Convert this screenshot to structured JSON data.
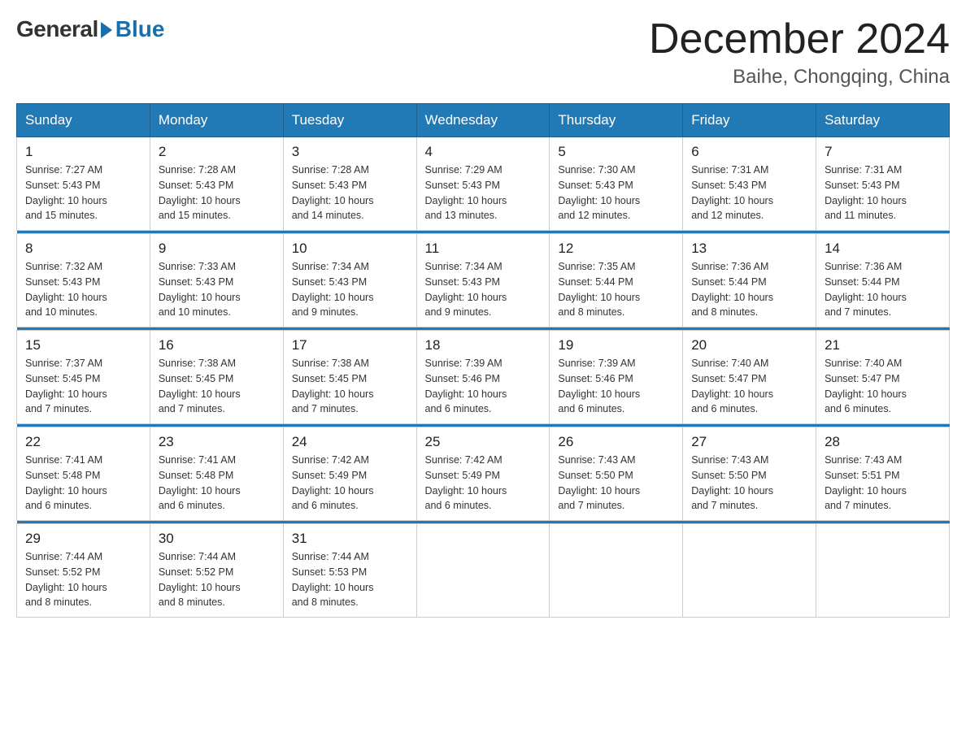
{
  "header": {
    "logo_general": "General",
    "logo_blue": "Blue",
    "month_title": "December 2024",
    "location": "Baihe, Chongqing, China"
  },
  "weekdays": [
    "Sunday",
    "Monday",
    "Tuesday",
    "Wednesday",
    "Thursday",
    "Friday",
    "Saturday"
  ],
  "weeks": [
    [
      {
        "day": "1",
        "sunrise": "7:27 AM",
        "sunset": "5:43 PM",
        "daylight": "10 hours and 15 minutes."
      },
      {
        "day": "2",
        "sunrise": "7:28 AM",
        "sunset": "5:43 PM",
        "daylight": "10 hours and 15 minutes."
      },
      {
        "day": "3",
        "sunrise": "7:28 AM",
        "sunset": "5:43 PM",
        "daylight": "10 hours and 14 minutes."
      },
      {
        "day": "4",
        "sunrise": "7:29 AM",
        "sunset": "5:43 PM",
        "daylight": "10 hours and 13 minutes."
      },
      {
        "day": "5",
        "sunrise": "7:30 AM",
        "sunset": "5:43 PM",
        "daylight": "10 hours and 12 minutes."
      },
      {
        "day": "6",
        "sunrise": "7:31 AM",
        "sunset": "5:43 PM",
        "daylight": "10 hours and 12 minutes."
      },
      {
        "day": "7",
        "sunrise": "7:31 AM",
        "sunset": "5:43 PM",
        "daylight": "10 hours and 11 minutes."
      }
    ],
    [
      {
        "day": "8",
        "sunrise": "7:32 AM",
        "sunset": "5:43 PM",
        "daylight": "10 hours and 10 minutes."
      },
      {
        "day": "9",
        "sunrise": "7:33 AM",
        "sunset": "5:43 PM",
        "daylight": "10 hours and 10 minutes."
      },
      {
        "day": "10",
        "sunrise": "7:34 AM",
        "sunset": "5:43 PM",
        "daylight": "10 hours and 9 minutes."
      },
      {
        "day": "11",
        "sunrise": "7:34 AM",
        "sunset": "5:43 PM",
        "daylight": "10 hours and 9 minutes."
      },
      {
        "day": "12",
        "sunrise": "7:35 AM",
        "sunset": "5:44 PM",
        "daylight": "10 hours and 8 minutes."
      },
      {
        "day": "13",
        "sunrise": "7:36 AM",
        "sunset": "5:44 PM",
        "daylight": "10 hours and 8 minutes."
      },
      {
        "day": "14",
        "sunrise": "7:36 AM",
        "sunset": "5:44 PM",
        "daylight": "10 hours and 7 minutes."
      }
    ],
    [
      {
        "day": "15",
        "sunrise": "7:37 AM",
        "sunset": "5:45 PM",
        "daylight": "10 hours and 7 minutes."
      },
      {
        "day": "16",
        "sunrise": "7:38 AM",
        "sunset": "5:45 PM",
        "daylight": "10 hours and 7 minutes."
      },
      {
        "day": "17",
        "sunrise": "7:38 AM",
        "sunset": "5:45 PM",
        "daylight": "10 hours and 7 minutes."
      },
      {
        "day": "18",
        "sunrise": "7:39 AM",
        "sunset": "5:46 PM",
        "daylight": "10 hours and 6 minutes."
      },
      {
        "day": "19",
        "sunrise": "7:39 AM",
        "sunset": "5:46 PM",
        "daylight": "10 hours and 6 minutes."
      },
      {
        "day": "20",
        "sunrise": "7:40 AM",
        "sunset": "5:47 PM",
        "daylight": "10 hours and 6 minutes."
      },
      {
        "day": "21",
        "sunrise": "7:40 AM",
        "sunset": "5:47 PM",
        "daylight": "10 hours and 6 minutes."
      }
    ],
    [
      {
        "day": "22",
        "sunrise": "7:41 AM",
        "sunset": "5:48 PM",
        "daylight": "10 hours and 6 minutes."
      },
      {
        "day": "23",
        "sunrise": "7:41 AM",
        "sunset": "5:48 PM",
        "daylight": "10 hours and 6 minutes."
      },
      {
        "day": "24",
        "sunrise": "7:42 AM",
        "sunset": "5:49 PM",
        "daylight": "10 hours and 6 minutes."
      },
      {
        "day": "25",
        "sunrise": "7:42 AM",
        "sunset": "5:49 PM",
        "daylight": "10 hours and 6 minutes."
      },
      {
        "day": "26",
        "sunrise": "7:43 AM",
        "sunset": "5:50 PM",
        "daylight": "10 hours and 7 minutes."
      },
      {
        "day": "27",
        "sunrise": "7:43 AM",
        "sunset": "5:50 PM",
        "daylight": "10 hours and 7 minutes."
      },
      {
        "day": "28",
        "sunrise": "7:43 AM",
        "sunset": "5:51 PM",
        "daylight": "10 hours and 7 minutes."
      }
    ],
    [
      {
        "day": "29",
        "sunrise": "7:44 AM",
        "sunset": "5:52 PM",
        "daylight": "10 hours and 8 minutes."
      },
      {
        "day": "30",
        "sunrise": "7:44 AM",
        "sunset": "5:52 PM",
        "daylight": "10 hours and 8 minutes."
      },
      {
        "day": "31",
        "sunrise": "7:44 AM",
        "sunset": "5:53 PM",
        "daylight": "10 hours and 8 minutes."
      },
      null,
      null,
      null,
      null
    ]
  ],
  "labels": {
    "sunrise": "Sunrise:",
    "sunset": "Sunset:",
    "daylight": "Daylight:"
  }
}
